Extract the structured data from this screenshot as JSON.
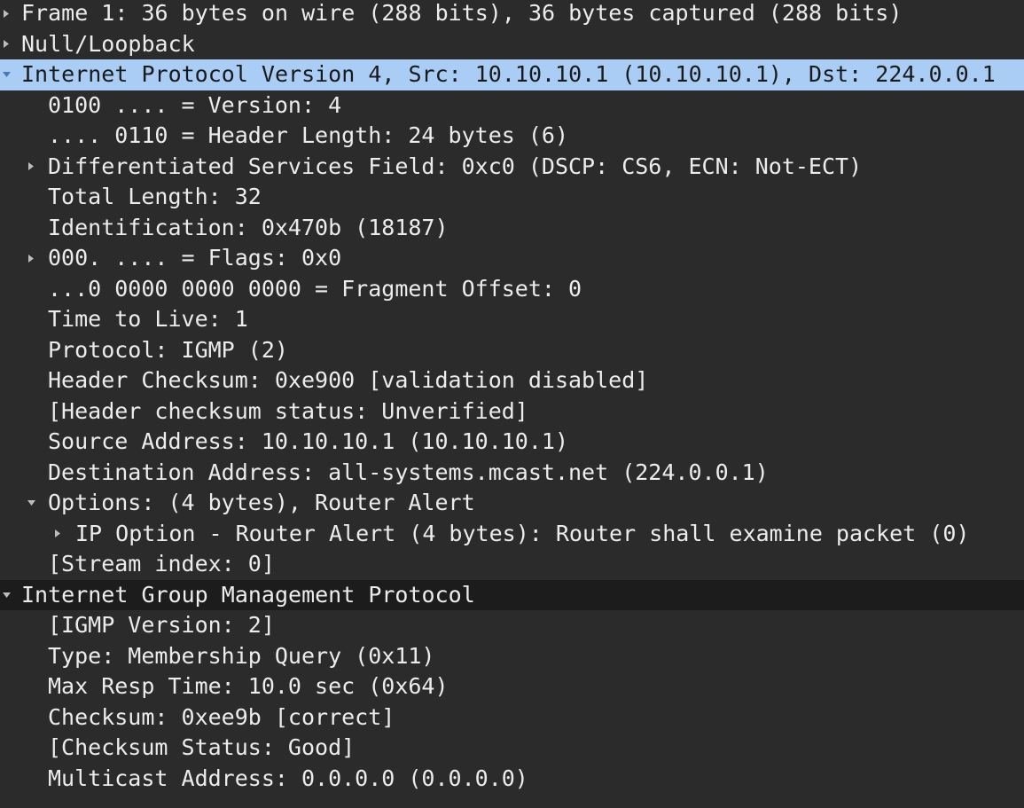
{
  "packet_details": {
    "rows": [
      {
        "level": 0,
        "expander": "right",
        "text": "Frame 1: 36 bytes on wire (288 bits), 36 bytes captured (288 bits)"
      },
      {
        "level": 0,
        "expander": "right",
        "text": "Null/Loopback"
      },
      {
        "level": 0,
        "expander": "down",
        "state": "selected",
        "text": "Internet Protocol Version 4, Src: 10.10.10.1 (10.10.10.1), Dst: 224.0.0.1"
      },
      {
        "level": 1,
        "expander": "none",
        "text": "0100 .... = Version: 4"
      },
      {
        "level": 1,
        "expander": "none",
        "text": ".... 0110 = Header Length: 24 bytes (6)"
      },
      {
        "level": 1,
        "expander": "right",
        "text": "Differentiated Services Field: 0xc0 (DSCP: CS6, ECN: Not-ECT)"
      },
      {
        "level": 1,
        "expander": "none",
        "text": "Total Length: 32"
      },
      {
        "level": 1,
        "expander": "none",
        "text": "Identification: 0x470b (18187)"
      },
      {
        "level": 1,
        "expander": "right",
        "text": "000. .... = Flags: 0x0"
      },
      {
        "level": 1,
        "expander": "none",
        "text": "...0 0000 0000 0000 = Fragment Offset: 0"
      },
      {
        "level": 1,
        "expander": "none",
        "text": "Time to Live: 1"
      },
      {
        "level": 1,
        "expander": "none",
        "text": "Protocol: IGMP (2)"
      },
      {
        "level": 1,
        "expander": "none",
        "text": "Header Checksum: 0xe900 [validation disabled]"
      },
      {
        "level": 1,
        "expander": "none",
        "text": "[Header checksum status: Unverified]"
      },
      {
        "level": 1,
        "expander": "none",
        "text": "Source Address: 10.10.10.1 (10.10.10.1)"
      },
      {
        "level": 1,
        "expander": "none",
        "text": "Destination Address: all-systems.mcast.net (224.0.0.1)"
      },
      {
        "level": 1,
        "expander": "down",
        "text": "Options: (4 bytes), Router Alert"
      },
      {
        "level": 2,
        "expander": "right",
        "text": "IP Option - Router Alert (4 bytes): Router shall examine packet (0)"
      },
      {
        "level": 1,
        "expander": "none",
        "text": "[Stream index: 0]"
      },
      {
        "level": 0,
        "expander": "down",
        "state": "hover",
        "text": "Internet Group Management Protocol"
      },
      {
        "level": 1,
        "expander": "none",
        "text": "[IGMP Version: 2]"
      },
      {
        "level": 1,
        "expander": "none",
        "text": "Type: Membership Query (0x11)"
      },
      {
        "level": 1,
        "expander": "none",
        "text": "Max Resp Time: 10.0 sec (0x64)"
      },
      {
        "level": 1,
        "expander": "none",
        "text": "Checksum: 0xee9b [correct]"
      },
      {
        "level": 1,
        "expander": "none",
        "text": "[Checksum Status: Good]"
      },
      {
        "level": 1,
        "expander": "none",
        "text": "Multicast Address: 0.0.0.0 (0.0.0.0)"
      }
    ]
  },
  "colors": {
    "background": "#2b2b2b",
    "text": "#ececec",
    "selected_row": "#a9cdf4",
    "hover_row": "#1c1c1c"
  }
}
